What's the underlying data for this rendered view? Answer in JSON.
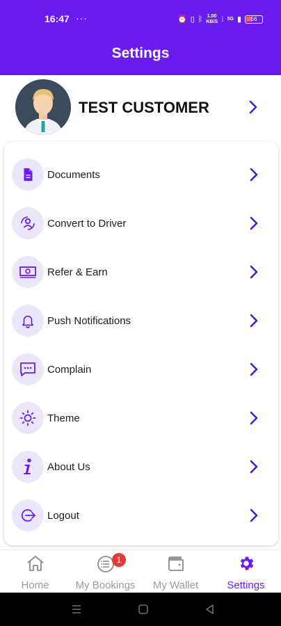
{
  "status_bar": {
    "time": "16:47",
    "dots": "···",
    "network_speed": "1.00\nKB/S",
    "signal_label": "5G",
    "battery_level": "56"
  },
  "header": {
    "title": "Settings"
  },
  "profile": {
    "name": "TEST CUSTOMER"
  },
  "menu": {
    "items": [
      {
        "label": "Documents",
        "icon": "document-icon"
      },
      {
        "label": "Convert to Driver",
        "icon": "convert-driver-icon"
      },
      {
        "label": "Refer & Earn",
        "icon": "money-icon"
      },
      {
        "label": "Push Notifications",
        "icon": "bell-icon"
      },
      {
        "label": "Complain",
        "icon": "chat-icon"
      },
      {
        "label": "Theme",
        "icon": "sun-icon"
      },
      {
        "label": "About Us",
        "icon": "info-icon"
      },
      {
        "label": "Logout",
        "icon": "logout-icon"
      }
    ]
  },
  "bottom_nav": {
    "items": [
      {
        "label": "Home",
        "icon": "home-icon"
      },
      {
        "label": "My Bookings",
        "icon": "list-icon",
        "badge": "1"
      },
      {
        "label": "My Wallet",
        "icon": "wallet-icon"
      },
      {
        "label": "Settings",
        "icon": "gear-icon",
        "active": true
      }
    ]
  },
  "colors": {
    "primary": "#6a1bf0",
    "chevron": "#3d1fd9",
    "icon_bg": "#ece6fb",
    "badge": "#e53935"
  }
}
